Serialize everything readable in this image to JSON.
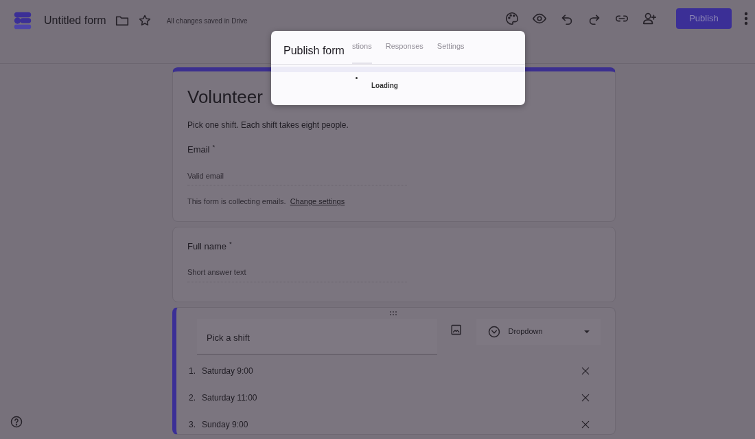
{
  "header": {
    "title": "Untitled form",
    "status": "All changes saved in Drive",
    "publish_button": "Publish"
  },
  "dialog": {
    "title": "Publish form",
    "tabs": [
      {
        "label": "stions",
        "selected": true
      },
      {
        "label": "Responses",
        "selected": false
      },
      {
        "label": "Settings",
        "selected": false
      }
    ],
    "loading_text": "Loading",
    "level": 1
  },
  "form_header": {
    "title": "Volunteer",
    "description": "Pick one shift. Each shift takes eight people.",
    "email_label": "Email",
    "required_mark": "*",
    "email_placeholder": "Valid email",
    "notice": "This form is collecting emails.",
    "notice_link": "Change settings"
  },
  "questions": [
    {
      "kind": "short",
      "title": "Full name",
      "required_mark": "*",
      "placeholder": "Short answer text"
    },
    {
      "kind": "dropdown",
      "title": "Pick a shift",
      "type": "Dropdown",
      "selected": true,
      "options": [
        {
          "number": "1.",
          "label": "Saturday 9:00"
        },
        {
          "number": "2.",
          "label": "Saturday 11:00"
        },
        {
          "number": "3.",
          "label": "Sunday 9:00"
        }
      ]
    }
  ]
}
